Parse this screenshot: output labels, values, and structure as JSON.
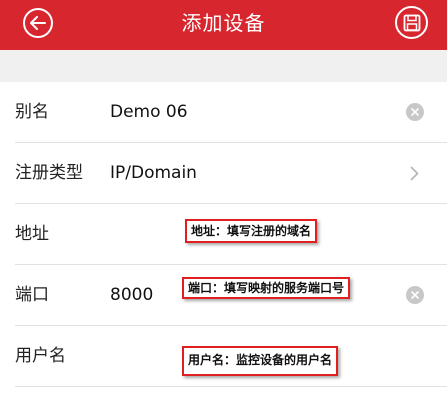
{
  "header": {
    "title": "添加设备",
    "back_icon": "back-arrow-icon",
    "save_icon": "save-icon",
    "color": "#d8262f"
  },
  "form": {
    "alias": {
      "label": "别名",
      "value": "Demo 06"
    },
    "register_type": {
      "label": "注册类型",
      "value": "IP/Domain"
    },
    "address": {
      "label": "地址",
      "value": ""
    },
    "port": {
      "label": "端口",
      "value": "8000"
    },
    "username": {
      "label": "用户名",
      "value": ""
    }
  },
  "annotations": {
    "address_note": "地址：填写注册的域名",
    "port_note": "端口：填写映射的服务端口号",
    "username_note": "用户名：监控设备的用户名"
  }
}
